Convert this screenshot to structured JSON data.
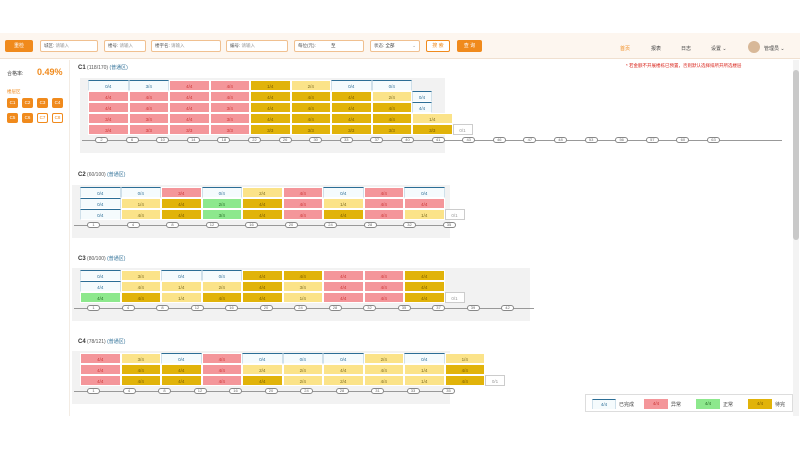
{
  "toolbar": {
    "reset_label": "重检",
    "fields": [
      {
        "label": "城区:",
        "placeholder": "请输入"
      },
      {
        "label": "楼号:",
        "placeholder": "请输入"
      },
      {
        "label": "楼宇名:",
        "placeholder": "请输入"
      },
      {
        "label": "编号:",
        "placeholder": "请输入"
      },
      {
        "label": "每位(元):",
        "value": "至"
      },
      {
        "label": "状态:",
        "value": "全部"
      }
    ],
    "search_label": "搜 索",
    "query_label": "查 询"
  },
  "nav": {
    "items": [
      "首页",
      "报表",
      "日志",
      "设置"
    ],
    "active": 0,
    "user": "管理员"
  },
  "left": {
    "rate_label": "合格率:",
    "rate_value": "0.49%",
    "area_label": "楼层区",
    "areas": [
      {
        "label": "C1",
        "on": true
      },
      {
        "label": "C2",
        "on": true
      },
      {
        "label": "C3",
        "on": true
      },
      {
        "label": "C4",
        "on": true
      },
      {
        "label": "C5",
        "on": true
      },
      {
        "label": "C6",
        "on": true
      },
      {
        "label": "C7",
        "on": false
      },
      {
        "label": "C8",
        "on": false
      }
    ]
  },
  "notice": "* 若金额不开展楼栋已预置，否则默认选择排所开所选楼层",
  "colors": {
    "white": "#f5fbfd",
    "red": "#f4969a",
    "yellow": "#e1b30a",
    "light_yellow": "#fbe389",
    "green": "#8de88d"
  },
  "sections": [
    {
      "title": "C1",
      "count": "(118/170)",
      "tag": "(普通区)",
      "rows": [
        [
          "0/4:w",
          "3/4:w",
          "4/4:r",
          "4/4:r",
          "1/4:y",
          "2/4:ly",
          "0/4:w",
          "0/4:w"
        ],
        [
          "4/4:r",
          "4/4:r",
          "4/4:r",
          "4/4:r",
          "4/4:y",
          "4/4:y",
          "4/4:y",
          "2/4:ly",
          "0/4:w"
        ],
        [
          "4/4:r",
          "4/4:r",
          "4/4:r",
          "3/4:r",
          "4/4:y",
          "4/4:y",
          "4/4:y",
          "4/4:y",
          "4/4:w"
        ],
        [
          "3/4:r",
          "3/4:r",
          "4/4:r",
          "3/4:r",
          "4/4:y",
          "4/4:y",
          "4/4:y",
          "4/4:y",
          "1/4:ly"
        ],
        [
          "3/4:r",
          "3/3:r",
          "3/3:r",
          "3/3:r",
          "3/3:y",
          "3/3:y",
          "3/3:y",
          "3/3:y",
          "3/3:y",
          "0/1:e"
        ]
      ],
      "ticks": [
        "2",
        "6",
        "10",
        "14",
        "18",
        "22",
        "26",
        "30",
        "33",
        "37",
        "40",
        "41",
        "43",
        "46",
        "47",
        "48",
        "53",
        "56",
        "57",
        "60",
        "63"
      ]
    },
    {
      "title": "C2",
      "count": "(60/100)",
      "tag": "(普通区)",
      "rows": [
        [
          "0/4:w",
          "0/4:w",
          "3/4:r",
          "0/4:w",
          "2/4:ly",
          "4/4:r",
          "0/4:w",
          "4/4:r",
          "0/4:w"
        ],
        [
          "0/4:w",
          "1/4:ly",
          "4/4:y",
          "2/4:g",
          "4/4:y",
          "4/4:r",
          "1/4:ly",
          "4/4:r",
          "4/4:r"
        ],
        [
          "0/4:w",
          "4/4:ly",
          "4/4:y",
          "3/4:g",
          "4/4:y",
          "4/4:r",
          "4/4:y",
          "4/4:r",
          "1/4:ly",
          "0/1:e"
        ]
      ],
      "ticks": [
        "1",
        "4",
        "8",
        "12",
        "16",
        "20",
        "24",
        "28",
        "32",
        "35"
      ]
    },
    {
      "title": "C3",
      "count": "(80/100)",
      "tag": "(普通区)",
      "rows": [
        [
          "0/4:w",
          "3/4:ly",
          "0/4:w",
          "0/4:w",
          "4/4:y",
          "4/4:y",
          "4/4:r",
          "4/4:r",
          "4/4:y"
        ],
        [
          "4/4:w",
          "4/4:ly",
          "1/4:ly",
          "2/4:ly",
          "4/4:y",
          "3/4:ly",
          "4/4:r",
          "4/4:r",
          "4/4:y"
        ],
        [
          "4/4:g",
          "4/4:y",
          "1/4:ly",
          "4/4:y",
          "4/4:y",
          "1/4:ly",
          "4/4:r",
          "4/4:r",
          "4/4:y",
          "0/1:e"
        ]
      ],
      "ticks": [
        "1",
        "4",
        "8",
        "12",
        "16",
        "20",
        "24",
        "28",
        "32",
        "35",
        "37",
        "39",
        "42"
      ]
    },
    {
      "title": "C4",
      "count": "(78/121)",
      "tag": "(普通区)",
      "rows": [
        [
          "4/4:r",
          "3/4:ly",
          "0/4:w",
          "4/4:r",
          "0/4:w",
          "0/4:w",
          "0/4:w",
          "2/4:ly",
          "0/4:w",
          "1/4:ly"
        ],
        [
          "4/4:r",
          "4/4:y",
          "4/4:y",
          "4/4:r",
          "2/4:ly",
          "2/4:ly",
          "4/4:ly",
          "4/4:ly",
          "1/4:ly",
          "4/4:y"
        ],
        [
          "4/4:r",
          "4/4:y",
          "4/4:y",
          "4/4:r",
          "4/4:y",
          "2/4:ly",
          "2/4:ly",
          "4/4:ly",
          "1/4:ly",
          "4/4:y",
          "0/1:e"
        ]
      ],
      "ticks": [
        "1",
        "4",
        "8",
        "12",
        "16",
        "20",
        "24",
        "28",
        "31",
        "33",
        "35"
      ]
    }
  ],
  "legend": [
    {
      "sample": "4/4",
      "type": "w",
      "label": "已完成"
    },
    {
      "sample": "4/4",
      "type": "r",
      "label": "异常"
    },
    {
      "sample": "4/4",
      "type": "g",
      "label": "正常"
    },
    {
      "sample": "4/4",
      "type": "y",
      "label": "待完"
    }
  ]
}
